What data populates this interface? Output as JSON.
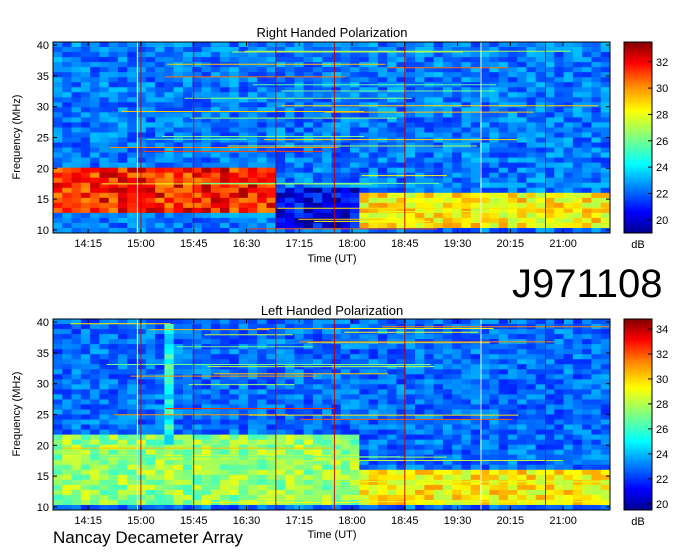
{
  "figure": {
    "id_label": "J971108",
    "credit": "Nancay Decameter Array"
  },
  "chart_data": [
    {
      "type": "heatmap",
      "title": "Right Handed Polarization",
      "xlabel": "Time (UT)",
      "ylabel": "Frequency (MHz)",
      "x_ticks": [
        "14:15",
        "15:00",
        "15:45",
        "16:30",
        "17:15",
        "18:00",
        "18:45",
        "19:30",
        "20:15",
        "21:00"
      ],
      "x_range": [
        "13:45",
        "21:40"
      ],
      "y_ticks": [
        10,
        15,
        20,
        25,
        30,
        35,
        40
      ],
      "ylim": [
        9.5,
        40.5
      ],
      "colorbar": {
        "label": "dB",
        "ticks": [
          20,
          22,
          24,
          26,
          28,
          30,
          32
        ],
        "range": [
          19,
          33.5
        ]
      },
      "colormap": [
        "#00008f",
        "#0000ff",
        "#0080ff",
        "#00ffff",
        "#80ff80",
        "#ffff00",
        "#ff8000",
        "#ff0000",
        "#800000"
      ],
      "features": [
        {
          "start": "13:45",
          "end": "16:55",
          "freq_min": 13,
          "freq_max": 20,
          "level_db": 33,
          "description": "intense emission"
        },
        {
          "start": "16:55",
          "end": "18:10",
          "freq_min": 10,
          "freq_max": 17,
          "level_db": 22
        },
        {
          "start": "18:10",
          "end": "21:40",
          "freq_min": 10,
          "freq_max": 16,
          "level_db": 30
        }
      ]
    },
    {
      "type": "heatmap",
      "title": "Left Handed Polarization",
      "xlabel": "Time (UT)",
      "ylabel": "Frequency (MHz)",
      "x_ticks": [
        "14:15",
        "15:00",
        "15:45",
        "16:30",
        "17:15",
        "18:00",
        "18:45",
        "19:30",
        "20:15",
        "21:00"
      ],
      "x_range": [
        "13:45",
        "21:40"
      ],
      "y_ticks": [
        10,
        15,
        20,
        25,
        30,
        35,
        40
      ],
      "ylim": [
        9.5,
        40.5
      ],
      "colorbar": {
        "label": "dB",
        "ticks": [
          20,
          22,
          24,
          26,
          28,
          30,
          32,
          34
        ],
        "range": [
          19.5,
          34.8
        ]
      },
      "colormap": [
        "#00008f",
        "#0000ff",
        "#0080ff",
        "#00ffff",
        "#80ff80",
        "#ffff00",
        "#ff8000",
        "#ff0000",
        "#800000"
      ],
      "features": [
        {
          "start": "13:45",
          "end": "18:10",
          "freq_min": 10,
          "freq_max": 22,
          "level_db": 29
        },
        {
          "start": "15:20",
          "end": "15:25",
          "freq_min": 20,
          "freq_max": 40,
          "level_db": 27
        },
        {
          "start": "18:10",
          "end": "21:40",
          "freq_min": 10,
          "freq_max": 16,
          "level_db": 31
        }
      ]
    }
  ]
}
